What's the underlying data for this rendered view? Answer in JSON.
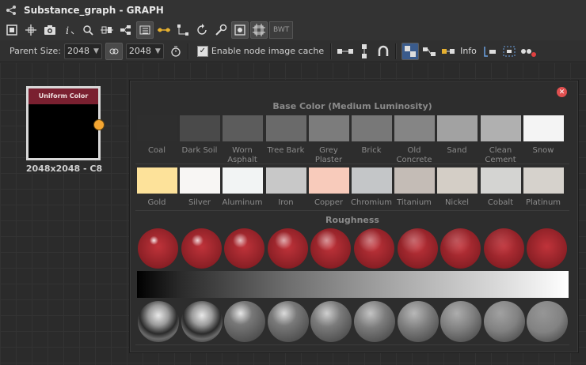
{
  "window": {
    "title": "Substance_graph - GRAPH"
  },
  "toolbar": {
    "bwt_label": "BWT",
    "parent_size_label": "Parent Size:",
    "parent_size_w": "2048",
    "parent_size_h": "2048",
    "cache_label": "Enable node image cache",
    "cache_checked": true,
    "info_label": "Info"
  },
  "node": {
    "title": "Uniform Color",
    "caption": "2048x2048 - C8",
    "port_color": "#f4a632"
  },
  "panel": {
    "base_color_title": "Base Color (Medium Luminosity)",
    "roughness_title": "Roughness",
    "row1": [
      {
        "label": "Coal",
        "color": "#2e2e2e"
      },
      {
        "label": "Dark Soil",
        "color": "#4a4a4a"
      },
      {
        "label": "Worn Asphalt",
        "color": "#5c5c5c"
      },
      {
        "label": "Tree Bark",
        "color": "#6a6a6a"
      },
      {
        "label": "Grey Plaster",
        "color": "#7c7c7c"
      },
      {
        "label": "Brick",
        "color": "#787878"
      },
      {
        "label": "Old Concrete",
        "color": "#858585"
      },
      {
        "label": "Sand",
        "color": "#a2a2a2"
      },
      {
        "label": "Clean Cement",
        "color": "#b0b0b0"
      },
      {
        "label": "Snow",
        "color": "#f4f4f4"
      }
    ],
    "row2": [
      {
        "label": "Gold",
        "color": "#fde29a"
      },
      {
        "label": "Silver",
        "color": "#f8f6f4"
      },
      {
        "label": "Aluminum",
        "color": "#f2f4f4"
      },
      {
        "label": "Iron",
        "color": "#c8c8c8"
      },
      {
        "label": "Copper",
        "color": "#f8cbbb"
      },
      {
        "label": "Chromium",
        "color": "#c4c6c8"
      },
      {
        "label": "Titanium",
        "color": "#c4bcb6"
      },
      {
        "label": "Nickel",
        "color": "#d4cec6"
      },
      {
        "label": "Cobalt",
        "color": "#d4d4d2"
      },
      {
        "label": "Platinum",
        "color": "#d6d2cc"
      }
    ],
    "roughness_ball_color": "#c0333a"
  }
}
